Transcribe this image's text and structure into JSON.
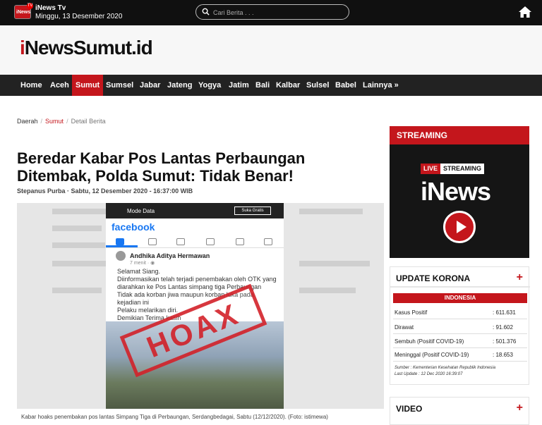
{
  "topbar": {
    "logo_text": "iNews",
    "logo_badge": "TV",
    "channel": "iNews Tv",
    "date": "Minggu, 13 Desember 2020",
    "search_placeholder": "Cari Berita . . ."
  },
  "brand": {
    "logo_prefix": "i",
    "logo_rest": "NewsSumut.id"
  },
  "nav": {
    "items": [
      "Home",
      "Aceh",
      "Sumut",
      "Sumsel",
      "Jabar",
      "Jateng",
      "Yogya",
      "Jatim",
      "Bali",
      "Kalbar",
      "Sulsel",
      "Babel",
      "Lainnya »"
    ],
    "active": "Sumut"
  },
  "breadcrumb": {
    "items": [
      "Daerah",
      "Sumut",
      "Detail Berita"
    ]
  },
  "article": {
    "title": "Beredar Kabar Pos Lantas Perbaungan Ditembak, Polda Sumut: Tidak Benar!",
    "byline": "Stepanus Purba · Sabtu, 12 Desember 2020 - 16:37:00 WIB",
    "image": {
      "status_label": "Mode Data",
      "status_button": "Suka Gratis",
      "fb_logo": "facebook",
      "post_author": "Andhika Aditya Hermawan",
      "post_time": "7 menit · ◉",
      "post_text": "Selamat Siang.\nDiinformasikan telah terjadi penembakan oleh OTK yang diarahkan ke Pos Lantas simpang tiga Perbaungan\nTidak ada korban jiwa maupun korban luka pada kejadian ini\nPelaku melarikan diri.\nDemikian Terima kasih",
      "stamp": "HOAX"
    },
    "caption": "Kabar hoaks penembakan pos lantas Simpang Tiga di Perbaungan, Serdangbedagai, Sabtu (12/12/2020). (Foto: istimewa)"
  },
  "sidebar": {
    "streaming": {
      "header": "STREAMING",
      "live": "LIVE",
      "streaming_label": "STREAMING",
      "logo": "iNews"
    },
    "korona": {
      "title": "UPDATE KORONA",
      "plus": "+",
      "region": "INDONESIA",
      "rows": [
        {
          "label": "Kasus Positif",
          "value": ": 611.631"
        },
        {
          "label": "Dirawat",
          "value": ": 91.602"
        },
        {
          "label": "Sembuh (Positif COVID-19)",
          "value": ": 501.376"
        },
        {
          "label": "Meninggal (Positif COVID-19)",
          "value": ": 18.653"
        }
      ],
      "source": "Sumber : Kementerian Kesehatan Republik Indonesia",
      "last_update": "Last Update : 12 Dec 2020 16:39:07"
    },
    "video": {
      "title": "VIDEO",
      "plus": "+"
    }
  },
  "colors": {
    "accent": "#c4161c",
    "topbar": "#101010",
    "nav": "#222222",
    "facebook": "#1877f2"
  }
}
